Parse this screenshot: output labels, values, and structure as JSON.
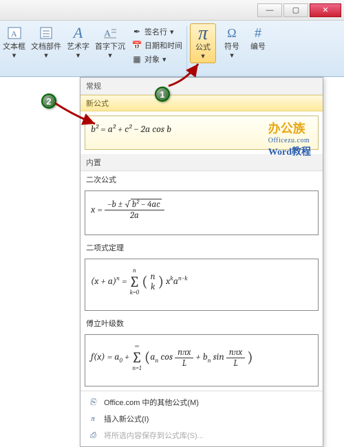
{
  "window": {
    "min": "—",
    "max": "▢",
    "close": "✕"
  },
  "ribbon": {
    "textbox": "文本框",
    "parts": "文档部件",
    "wordart": "艺术字",
    "dropcap": "首字下沉",
    "signature": "签名行",
    "datetime": "日期和时间",
    "object": "对象",
    "equation": "公式",
    "symbol": "符号",
    "number": "编号"
  },
  "callouts": {
    "one": "1",
    "two": "2"
  },
  "dropdown": {
    "header": "常规",
    "new_label": "新公式",
    "new_formula": "b² = a² + c² − 2a cos b",
    "builtin": "内置",
    "cat1": "二次公式",
    "cat2": "二项式定理",
    "cat3": "傅立叶级数",
    "footer1": "Office.com 中的其他公式(M)",
    "footer2": "插入新公式(I)",
    "footer3": "将所选内容保存到公式库(S)...",
    "logo": {
      "l1a": "办公",
      "l1b": "族",
      "l2": "Officezu.com",
      "l3": "Word教程"
    }
  },
  "formulas": {
    "quad_lhs": "x =",
    "quad_num_a": "−b ± ",
    "quad_num_rad": "b² − 4ac",
    "quad_den": "2a",
    "binom_lhs": "(x + a)",
    "binom_exp": "n",
    "binom_eq": " = ",
    "binom_sum_top": "n",
    "binom_sum_bot": "k=0",
    "binom_binom_top": "n",
    "binom_binom_bot": "k",
    "binom_tail": " x",
    "binom_tail_sup": "k",
    "binom_tail2": "a",
    "binom_tail2_sup": "n−k",
    "four_lhs": "f(x) = a",
    "four_sub0": "0",
    "four_plus": " + ",
    "four_sum_top": "∞",
    "four_sum_bot": "n=1",
    "four_an": "a",
    "four_an_sub": "n",
    "four_cos": " cos",
    "four_frac_num": "nπx",
    "four_frac_den": "L",
    "four_plus2": " + b",
    "four_bn_sub": "n",
    "four_sin": " sin"
  }
}
